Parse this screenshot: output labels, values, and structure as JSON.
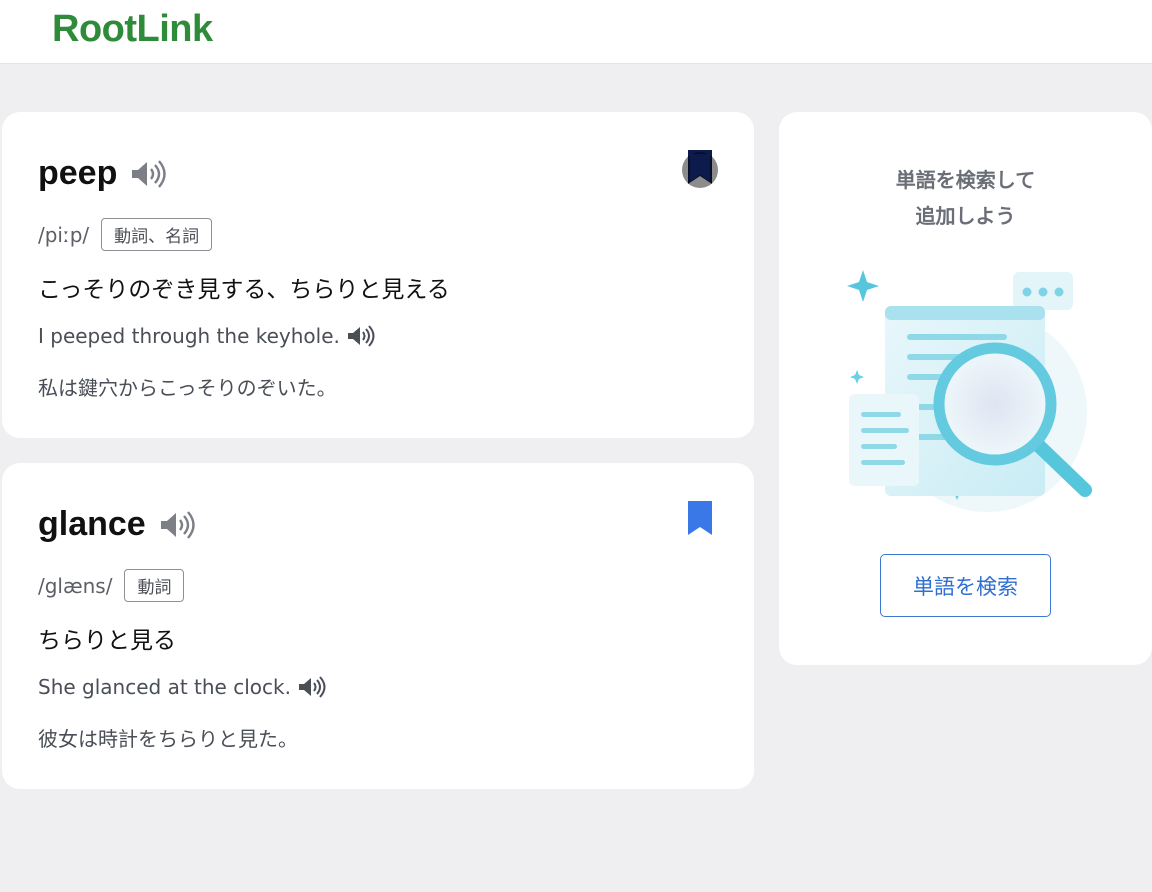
{
  "app": {
    "logo": "RootLink",
    "brand_color": "#2e8b3a"
  },
  "words": [
    {
      "word": "peep",
      "phonetic": "/piːp/",
      "pos": "動詞、名詞",
      "meaning": "こっそりのぞき見する、ちらりと見える",
      "example_en": "I peeped through the keyhole.",
      "example_ja": "私は鍵穴からこっそりのぞいた。",
      "bookmarked": true,
      "bookmark_color": "#0d1b4c"
    },
    {
      "word": "glance",
      "phonetic": "/glæns/",
      "pos": "動詞",
      "meaning": "ちらりと見る",
      "example_en": "She glanced at the clock.",
      "example_ja": "彼女は時計をちらりと見た。",
      "bookmarked": true,
      "bookmark_color": "#3b78e7"
    }
  ],
  "side_panel": {
    "title_line1": "単語を検索して",
    "title_line2": "追加しよう",
    "button_label": "単語を検索",
    "accent_color": "#2f6fd0"
  },
  "icons": {
    "speaker": "speaker-icon",
    "bookmark": "bookmark-icon",
    "illustration": "magnifier-document-illustration"
  }
}
